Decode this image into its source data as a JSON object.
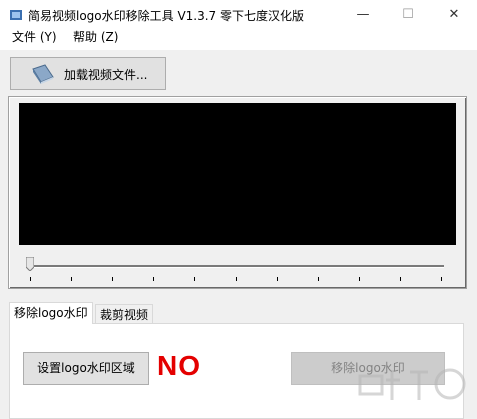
{
  "window": {
    "title": "简易视频logo水印移除工具 V1.3.7 零下七度汉化版",
    "minimize_glyph": "—",
    "maximize_glyph": "☐",
    "close_glyph": "✕"
  },
  "menu": {
    "file": "文件 (Y)",
    "help": "帮助 (Z)"
  },
  "toolbar": {
    "load_video_label": "加载视频文件...",
    "load_video_icon": "book-icon"
  },
  "player": {
    "video_background": "#000000",
    "slider_position": 0
  },
  "tabs": [
    {
      "label": "移除logo水印",
      "active": true
    },
    {
      "label": "裁剪视频",
      "active": false
    }
  ],
  "panel": {
    "set_region_label": "设置logo水印区域",
    "status_text": "NO",
    "status_color": "#e40000",
    "remove_label": "移除logo水印",
    "remove_enabled": false
  }
}
